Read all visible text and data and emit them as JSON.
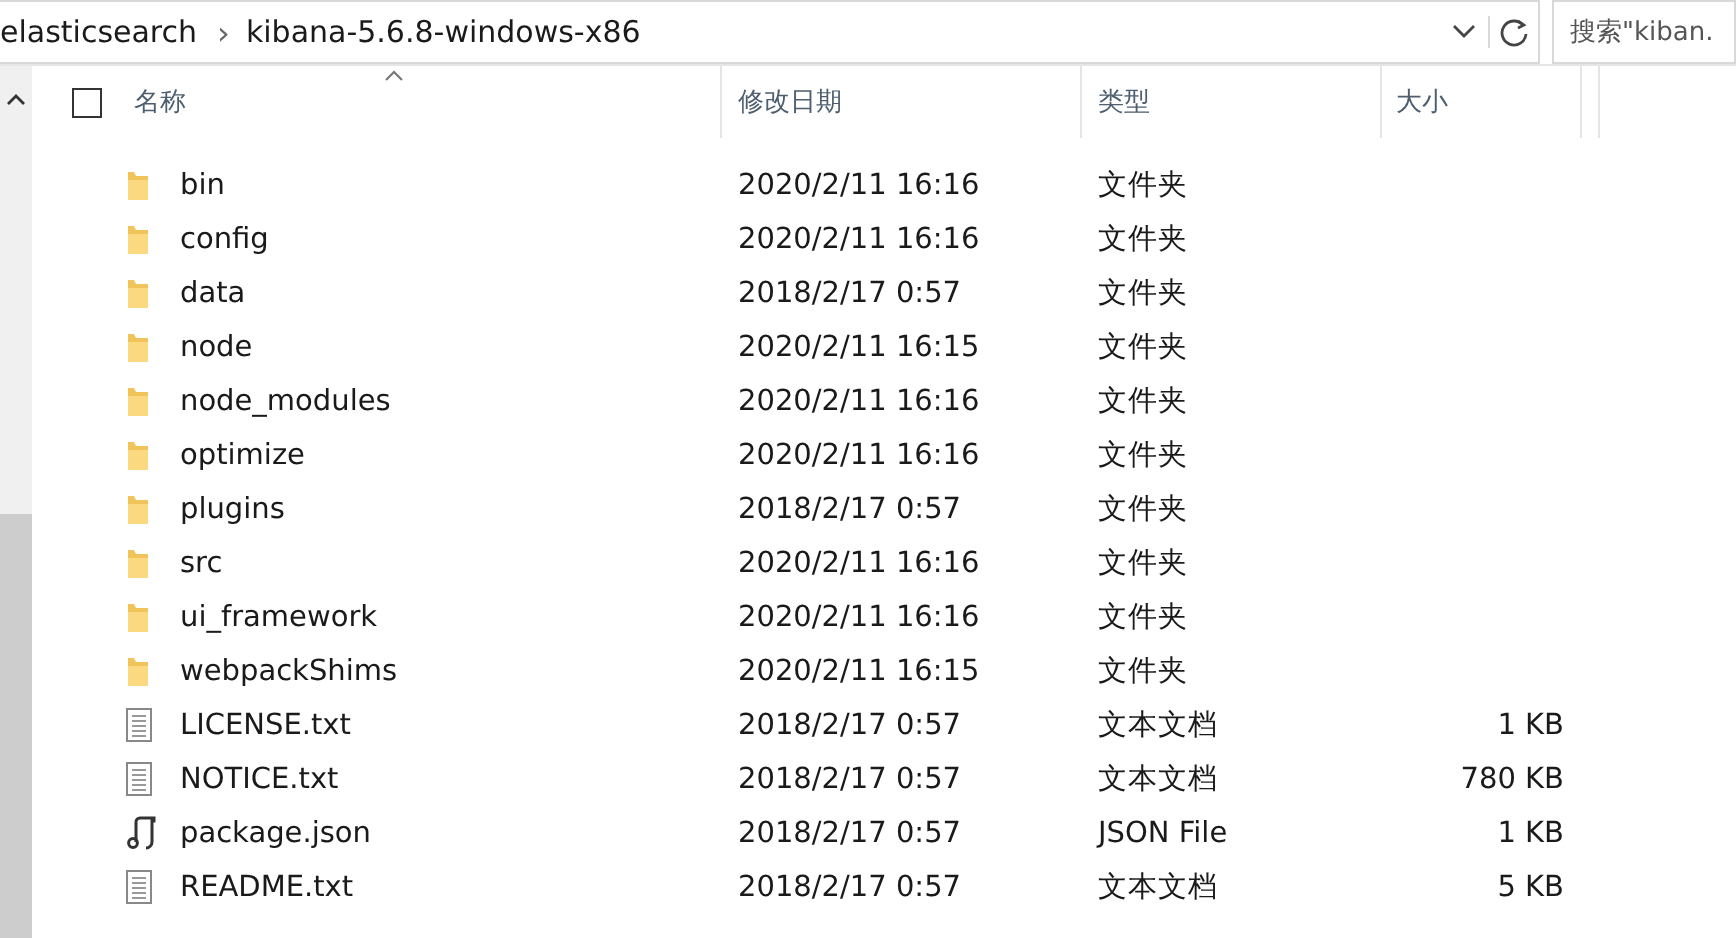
{
  "address_bar": {
    "path": [
      {
        "label": "elasticsearch"
      },
      {
        "label": "kibana-5.6.8-windows-x86"
      }
    ],
    "separator": "›",
    "search": {
      "placeholder": "搜索\"kiban."
    }
  },
  "table": {
    "select_all": {
      "checked": false
    },
    "columns": [
      {
        "label": "名称",
        "sorted": true
      },
      {
        "label": "修改日期",
        "sorted": false
      },
      {
        "label": "类型",
        "sorted": false
      },
      {
        "label": "大小",
        "sorted": false
      }
    ],
    "rows": [
      {
        "kind": "folder",
        "name": "bin",
        "modified": "2020/2/11 16:16",
        "type": "文件夹"
      },
      {
        "kind": "folder",
        "name": "config",
        "modified": "2020/2/11 16:16",
        "type": "文件夹"
      },
      {
        "kind": "folder",
        "name": "data",
        "modified": "2018/2/17 0:57",
        "type": "文件夹"
      },
      {
        "kind": "folder",
        "name": "node",
        "modified": "2020/2/11 16:15",
        "type": "文件夹"
      },
      {
        "kind": "folder",
        "name": "node_modules",
        "modified": "2020/2/11 16:16",
        "type": "文件夹"
      },
      {
        "kind": "folder",
        "name": "optimize",
        "modified": "2020/2/11 16:16",
        "type": "文件夹"
      },
      {
        "kind": "folder",
        "name": "plugins",
        "modified": "2018/2/17 0:57",
        "type": "文件夹"
      },
      {
        "kind": "folder",
        "name": "src",
        "modified": "2020/2/11 16:16",
        "type": "文件夹"
      },
      {
        "kind": "folder",
        "name": "ui_framework",
        "modified": "2020/2/11 16:16",
        "type": "文件夹"
      },
      {
        "kind": "folder",
        "name": "webpackShims",
        "modified": "2020/2/11 16:15",
        "type": "文件夹"
      },
      {
        "kind": "text",
        "name": "LICENSE.txt",
        "modified": "2018/2/17 0:57",
        "type": "文本文档",
        "size": "1 KB"
      },
      {
        "kind": "text",
        "name": "NOTICE.txt",
        "modified": "2018/2/17 0:57",
        "type": "文本文档",
        "size": "780 KB"
      },
      {
        "kind": "script",
        "name": "package.json",
        "modified": "2018/2/17 0:57",
        "type": "JSON File",
        "size": "1 KB"
      },
      {
        "kind": "text",
        "name": "README.txt",
        "modified": "2018/2/17 0:57",
        "type": "文本文档",
        "size": "5 KB"
      }
    ]
  }
}
